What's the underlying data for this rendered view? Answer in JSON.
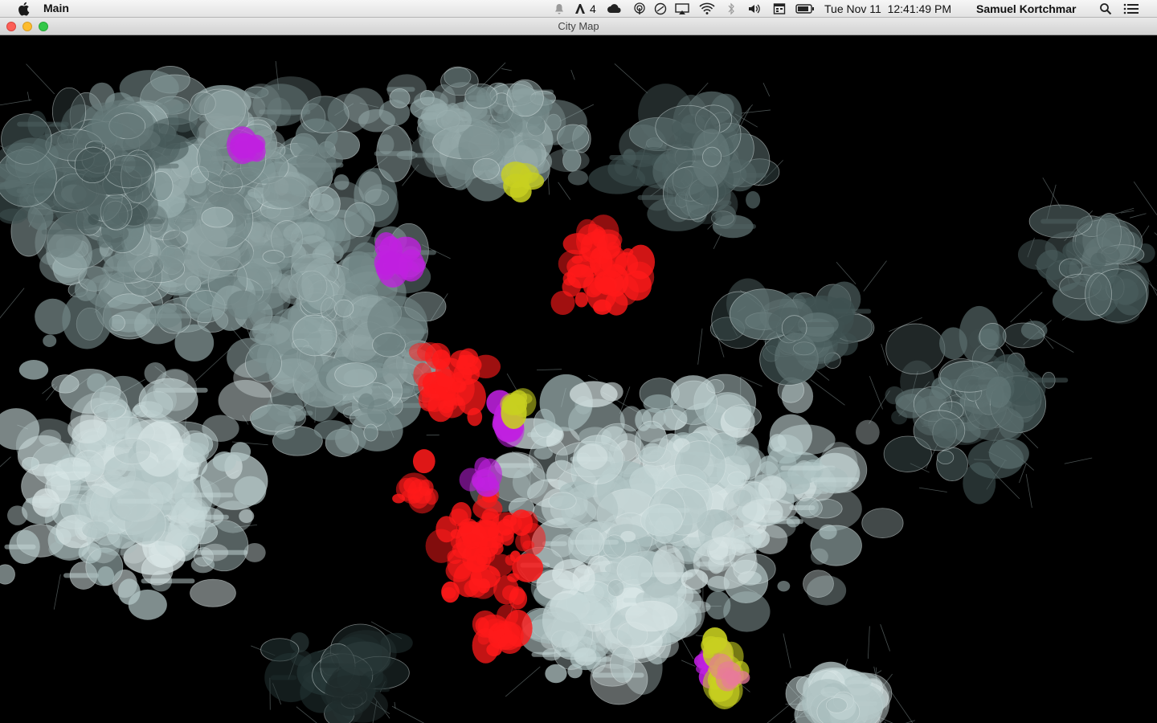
{
  "menubar": {
    "app_name": "Main",
    "notification_badge": "4",
    "datetime": "Tue Nov 11  12:41:49 PM",
    "user": "Samuel Kortchmar"
  },
  "window": {
    "title": "City Map"
  },
  "map": {
    "colors": {
      "base": "#8fa3a3",
      "dark": "#5a6d6d",
      "light": "#c5d7d7",
      "red": "#ff1a1a",
      "magenta": "#c020e0",
      "yellow": "#c8d020",
      "pink": "#e87a9a"
    }
  }
}
